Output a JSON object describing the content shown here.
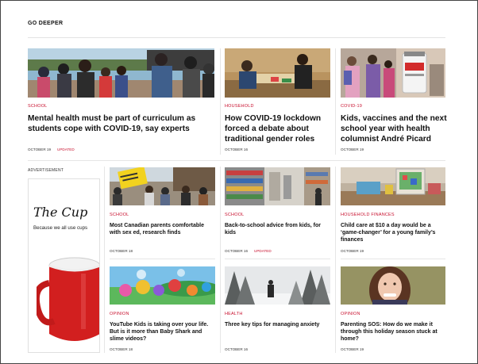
{
  "section": {
    "title": "GO DEEPER"
  },
  "advertisement": {
    "label": "ADVERTISEMENT",
    "title": "The Cup",
    "tagline": "Because we all use cups"
  },
  "top": [
    {
      "category": "SCHOOL",
      "headline": "Mental health must be part of curriculum as students cope with COVID-19, say experts",
      "date": "OCTOBER 19",
      "updated": "UPDATED"
    },
    {
      "category": "HOUSEHOLD",
      "headline": "How COVID-19 lockdown forced a debate about traditional gender roles",
      "date": "OCTOBER 16",
      "updated": ""
    },
    {
      "category": "COVID-19",
      "headline": "Kids, vaccines and the next school year with health columnist André Picard",
      "date": "OCTOBER 19",
      "updated": ""
    }
  ],
  "mid": [
    {
      "category": "SCHOOL",
      "headline": "Most Canadian parents comfortable with sex ed, research finds",
      "date": "OCTOBER 18",
      "updated": ""
    },
    {
      "category": "SCHOOL",
      "headline": "Back-to-school advice from kids, for kids",
      "date": "OCTOBER 16",
      "updated": "UPDATED"
    },
    {
      "category": "HOUSEHOLD FINANCES",
      "headline": "Child care at $10 a day would be a ‘game-changer’ for a young family’s finances",
      "date": "OCTOBER 19",
      "updated": ""
    }
  ],
  "bottom": [
    {
      "category": "OPINION",
      "headline": "YouTube Kids is taking over your life. But is it more than Baby Shark and slime videos?",
      "date": "OCTOBER 18",
      "updated": ""
    },
    {
      "category": "HEALTH",
      "headline": "Three key tips for managing anxiety",
      "date": "OCTOBER 16",
      "updated": ""
    },
    {
      "category": "OPINION",
      "headline": "Parenting SOS: How do we make it through this holiday season stuck at home?",
      "date": "OCTOBER 19",
      "updated": ""
    }
  ]
}
